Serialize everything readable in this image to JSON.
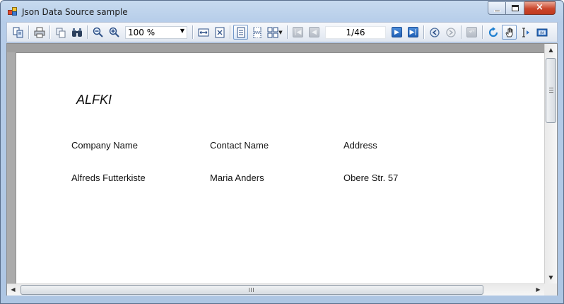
{
  "window": {
    "title": "Json Data Source sample",
    "controls": {
      "minimize": "minimize",
      "maximize": "maximize",
      "close": "×"
    }
  },
  "toolbar": {
    "zoom": {
      "value": "100 %"
    },
    "page_indicator": "1/46",
    "icons": [
      "copy-document-icon",
      "print-icon",
      "duplicate-icon",
      "find-icon",
      "zoom-out-icon",
      "zoom-in-icon",
      "fit-width-icon",
      "fit-page-icon",
      "single-page-icon",
      "continuous-page-icon",
      "multi-page-icon",
      "first-page-icon",
      "previous-page-icon",
      "next-page-icon",
      "last-page-icon",
      "back-icon",
      "forward-icon",
      "undo-icon",
      "refresh-icon",
      "hand-tool-icon",
      "text-select-icon",
      "snapshot-icon"
    ]
  },
  "report": {
    "group_title": "ALFKI",
    "columns": [
      "Company Name",
      "Contact Name",
      "Address"
    ],
    "rows": [
      [
        "Alfreds Futterkiste",
        "Maria Anders",
        "Obere Str. 57"
      ]
    ]
  },
  "colors": {
    "window_frame": "#b6cde9",
    "toolbar": "#e6ecf4",
    "viewer_background": "#ababab",
    "close_button": "#c9462c",
    "nav_button_active": "#1f5fb4"
  }
}
